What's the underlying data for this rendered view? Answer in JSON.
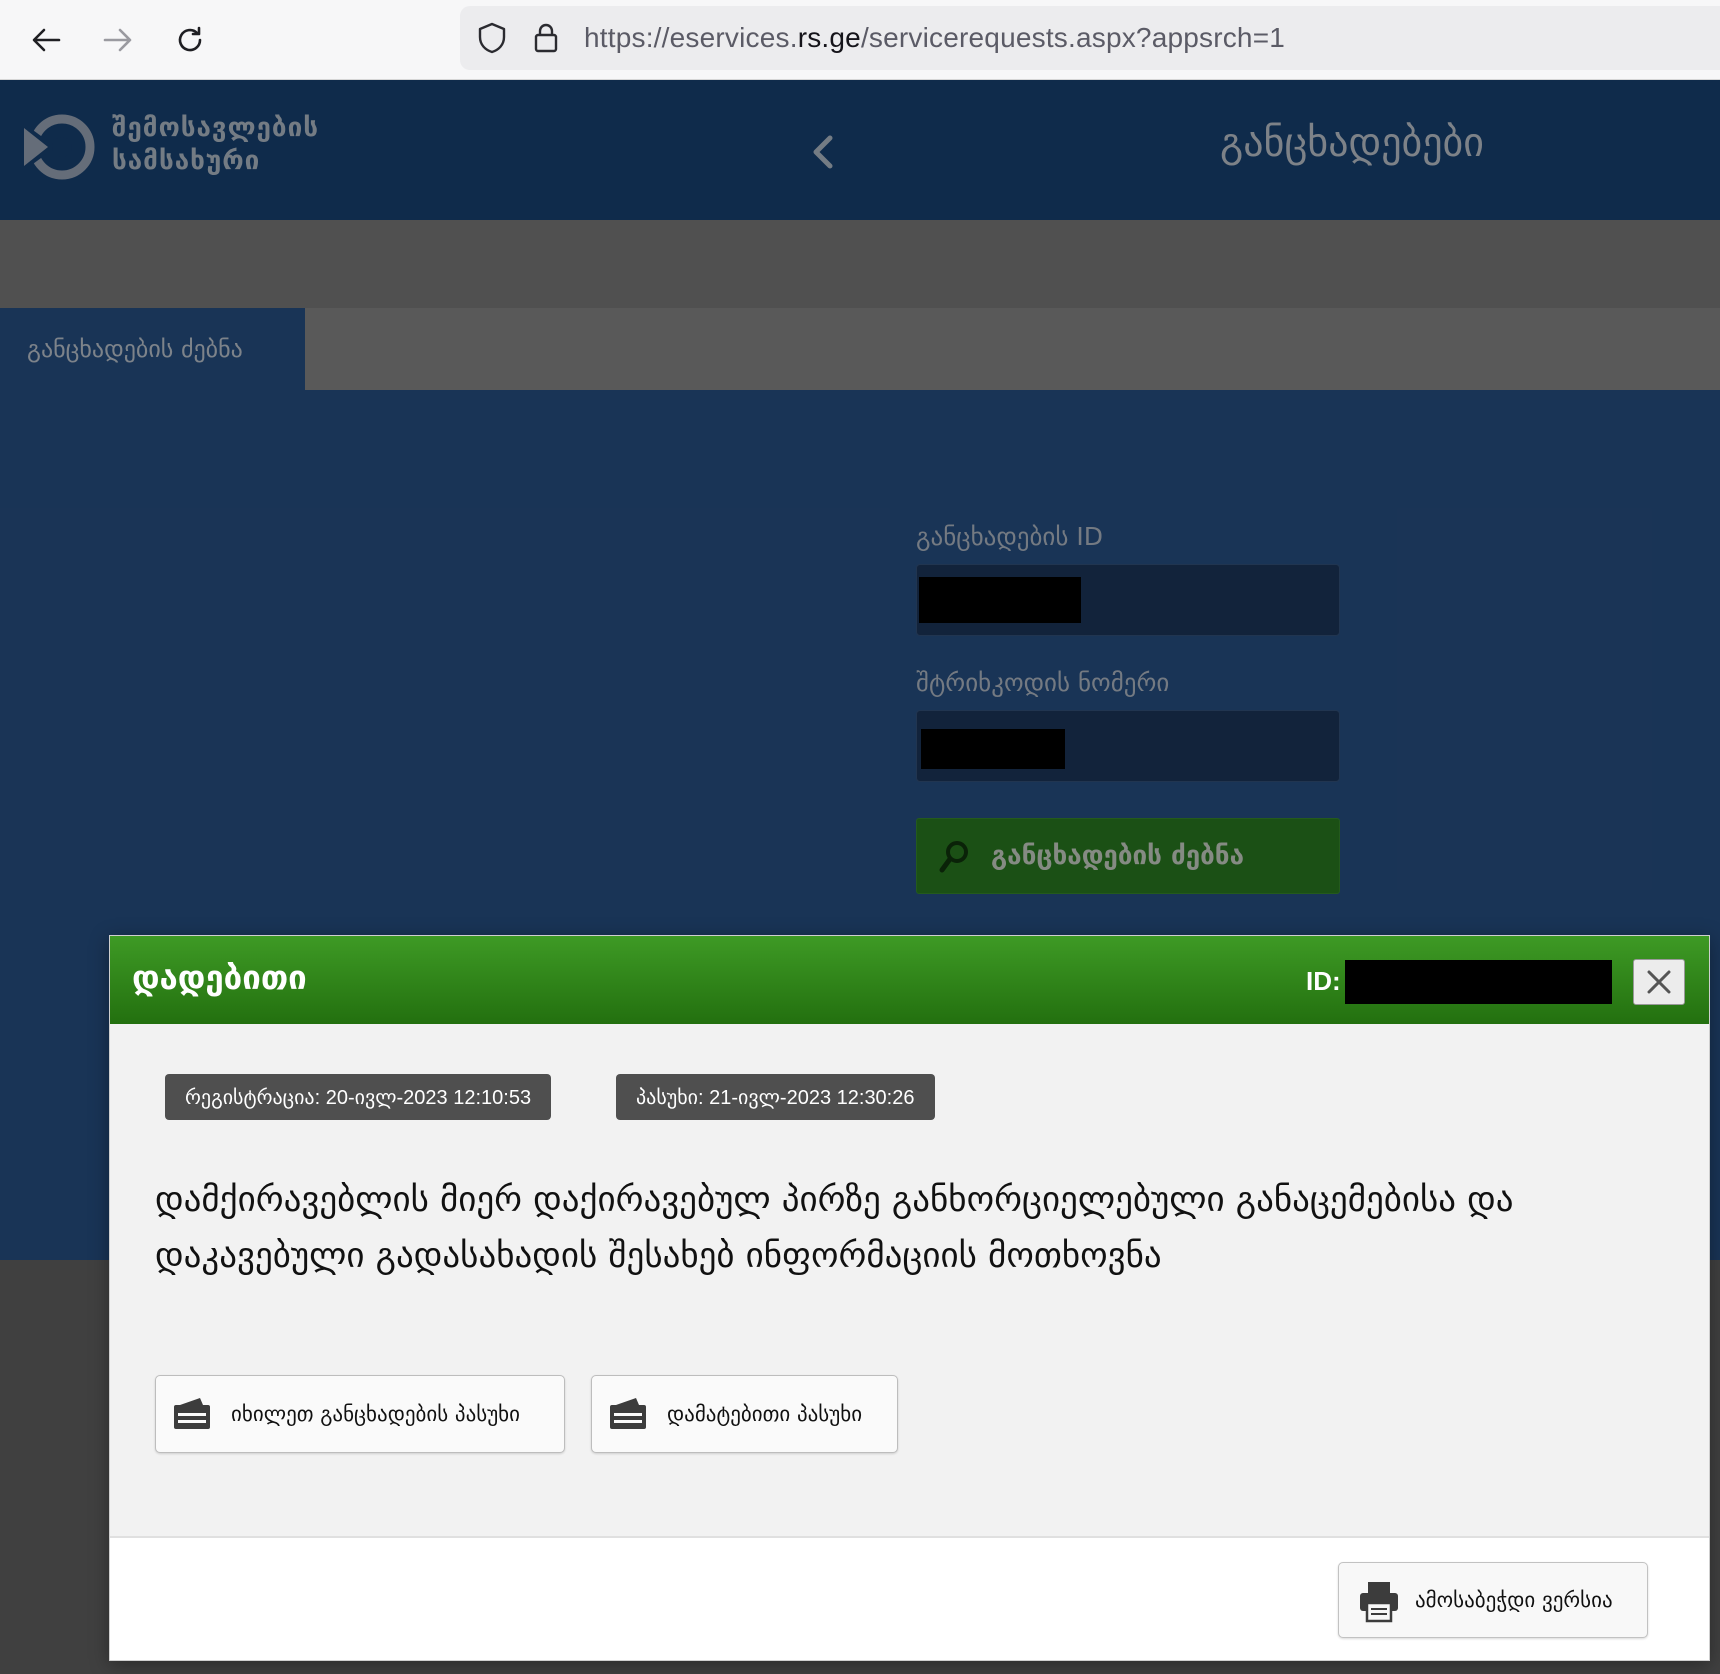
{
  "browser": {
    "url_prefix": "https://eservices.",
    "url_domain": "rs.ge",
    "url_suffix": "/servicerequests.aspx?appsrch=1",
    "back_icon": "back-arrow-icon",
    "forward_icon": "forward-arrow-icon",
    "reload_icon": "reload-icon",
    "shield_icon": "shield-icon",
    "lock_icon": "lock-icon"
  },
  "header": {
    "logo_line1": "შემოსავლების",
    "logo_line2": "სამსახური",
    "title": "განცხადებები"
  },
  "tabs": [
    {
      "label": "განცხადების ძებნა",
      "active": true
    }
  ],
  "search_form": {
    "id_label": "განცხადების ID",
    "barcode_label": "შტრიხკოდის ნომერი",
    "search_button": "განცხადების ძებნა"
  },
  "modal": {
    "status_title": "დადებითი",
    "id_label": "ID:",
    "registration": "რეგისტრაცია: 20-ივლ-2023 12:10:53",
    "response": "პასუხი: 21-ივლ-2023 12:30:26",
    "description": "დამქირავებლის მიერ დაქირავებულ პირზე განხორციელებული განაცემებისა და დაკავებული გადასახადის შესახებ ინფორმაციის მოთხოვნა",
    "view_response_button": "იხილეთ განცხადების პასუხი",
    "additional_response_button": "დამატებითი პასუხი",
    "print_button": "ამოსაბეჭდი ვერსია"
  },
  "colors": {
    "header_blue": "#1b4a82",
    "page_blue": "#2c5a94",
    "success_green": "#2f8a25"
  }
}
